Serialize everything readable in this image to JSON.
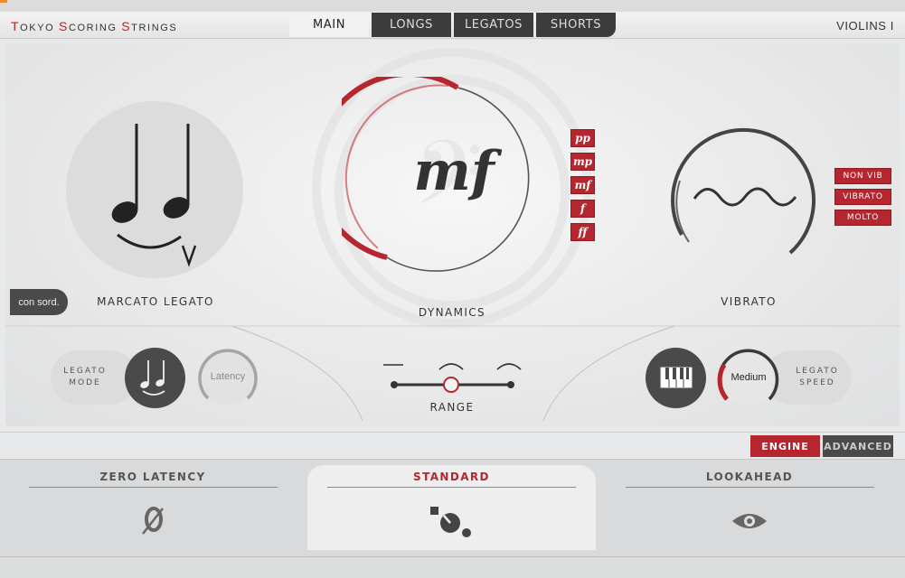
{
  "header": {
    "brand": {
      "t": "T",
      "okyo": "OKYO ",
      "s": "S",
      "coring": "CORING ",
      "s2": "S",
      "trings": "TRINGS"
    },
    "instrument": "VIOLINS I",
    "tabs": [
      "MAIN",
      "LONGS",
      "LEGATOS",
      "SHORTS"
    ]
  },
  "articulation": {
    "label": "MARCATO LEGATO",
    "con_sord": "con sord."
  },
  "dynamics": {
    "label": "DYNAMICS",
    "current": "mf",
    "buttons": [
      "pp",
      "mp",
      "mf",
      "f",
      "ff"
    ]
  },
  "vibrato": {
    "label": "VIBRATO",
    "buttons": [
      "NON VIB",
      "VIBRATO",
      "MOLTO"
    ]
  },
  "legato_mode": {
    "label_line1": "LEGATO",
    "label_line2": "MODE",
    "latency_knob": "Latency"
  },
  "range": {
    "label": "RANGE"
  },
  "legato_speed": {
    "label_line1": "LEGATO",
    "label_line2": "SPEED",
    "speed_knob": "Medium"
  },
  "engine_tabs": {
    "engine": "ENGINE",
    "advanced": "ADVANCED"
  },
  "modes": [
    {
      "title": "ZERO LATENCY",
      "icon": "zero-latency-icon"
    },
    {
      "title": "STANDARD",
      "icon": "standard-dial-icon"
    },
    {
      "title": "LOOKAHEAD",
      "icon": "eye-icon"
    }
  ],
  "colors": {
    "accent_red": "#b5262e",
    "dark": "#4a4a4a"
  }
}
